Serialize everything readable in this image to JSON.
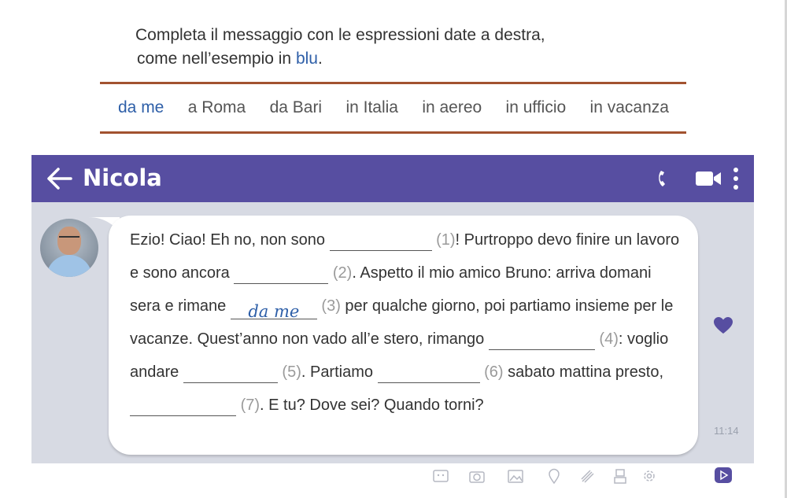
{
  "instructions": {
    "line1": "Completa il messaggio con le espressioni date a destra,",
    "line2_prefix": "come nell’esempio in ",
    "line2_blue": "blu",
    "line2_suffix": "."
  },
  "options": [
    "da me",
    "a Roma",
    "da Bari",
    "in Italia",
    "in aereo",
    "in ufficio",
    "in vacanza"
  ],
  "chat": {
    "back_icon": "back-arrow-icon",
    "contact_name": "Nicola",
    "header_icons": [
      "phone-icon",
      "video-camera-icon",
      "more-vertical-icon"
    ],
    "time": "11:14",
    "message": {
      "t1": "Ezio! Ciao! Eh no, non sono",
      "n1": "(1)",
      "t2": "! Purtroppo devo finire un lavoro e sono ancora",
      "n2": "(2)",
      "t3": ". Aspetto il mio amico Bruno: arriva domani sera e rimane",
      "example_answer": "da me",
      "n3": "(3)",
      "t4": "per qualche giorno, poi partiamo insieme per le vacanze. Quest’anno non vado all’e stero, rimango",
      "n4": "(4)",
      "t5": ": voglio andare",
      "n5": "(5)",
      "t6": ". Partiamo",
      "n6": "(6)",
      "t7": "sabato mattina presto,",
      "n7": "(7)",
      "t8": ". E tu? Dove sei? Quando torni?"
    },
    "toolbar_icons": [
      "sticker-icon",
      "camera-icon",
      "image-icon",
      "location-icon",
      "attach-icon",
      "contact-icon",
      "settings-icon",
      "send-icon"
    ],
    "colors": {
      "header": "#574ea1",
      "background": "#d7dae3",
      "rule": "#a2522f",
      "example_blue": "#2e5fa8"
    }
  }
}
